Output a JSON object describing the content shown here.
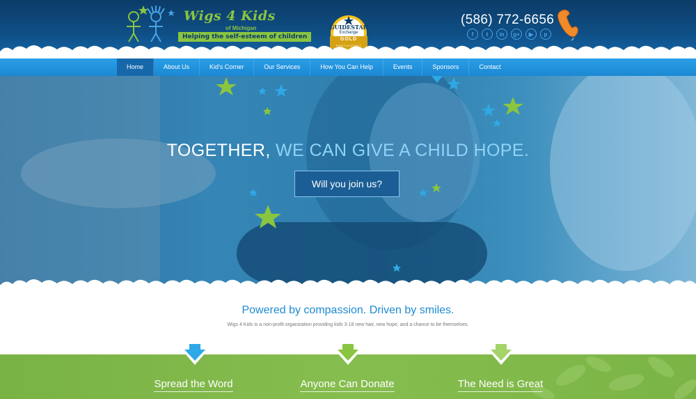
{
  "logo": {
    "title": "Wigs 4 Kids",
    "subtitle": "of Michigan",
    "tagline": "Helping the self-esteem of children"
  },
  "badge": {
    "line1": "GUIDESTAR",
    "line2": "Exchange",
    "line3": "GOLD",
    "line4": "PARTICIPANT"
  },
  "contact": {
    "phone": "(586) 772-6656",
    "social": [
      {
        "icon": "facebook-icon",
        "glyph": "f"
      },
      {
        "icon": "twitter-icon",
        "glyph": "t"
      },
      {
        "icon": "linkedin-icon",
        "glyph": "in"
      },
      {
        "icon": "google-plus-icon",
        "glyph": "g+"
      },
      {
        "icon": "youtube-icon",
        "glyph": "▶"
      },
      {
        "icon": "pinterest-icon",
        "glyph": "p"
      }
    ]
  },
  "nav": {
    "items": [
      "Home",
      "About Us",
      "Kid's Corner",
      "Our Services",
      "How You Can Help",
      "Events",
      "Sponsors",
      "Contact"
    ],
    "active": "Home"
  },
  "hero": {
    "title_part1": "TOGETHER,",
    "title_part2": "WE CAN GIVE A CHILD HOPE.",
    "cta": "Will you join us?"
  },
  "mission": {
    "heading": "Powered by compassion. Driven by smiles.",
    "text": "Wigs 4 Kids is a non-profit organization providing kids 3-18 new hair, new hope, and a chance to be themselves."
  },
  "features": [
    "Spread the Word",
    "Anyone Can Donate",
    "The Need is Great"
  ],
  "colors": {
    "header_bg": "#0f4f86",
    "nav_bg": "#1b88d4",
    "accent_green": "#8ac540",
    "accent_blue": "#1e8ad0",
    "band_green": "#86bd4f"
  }
}
